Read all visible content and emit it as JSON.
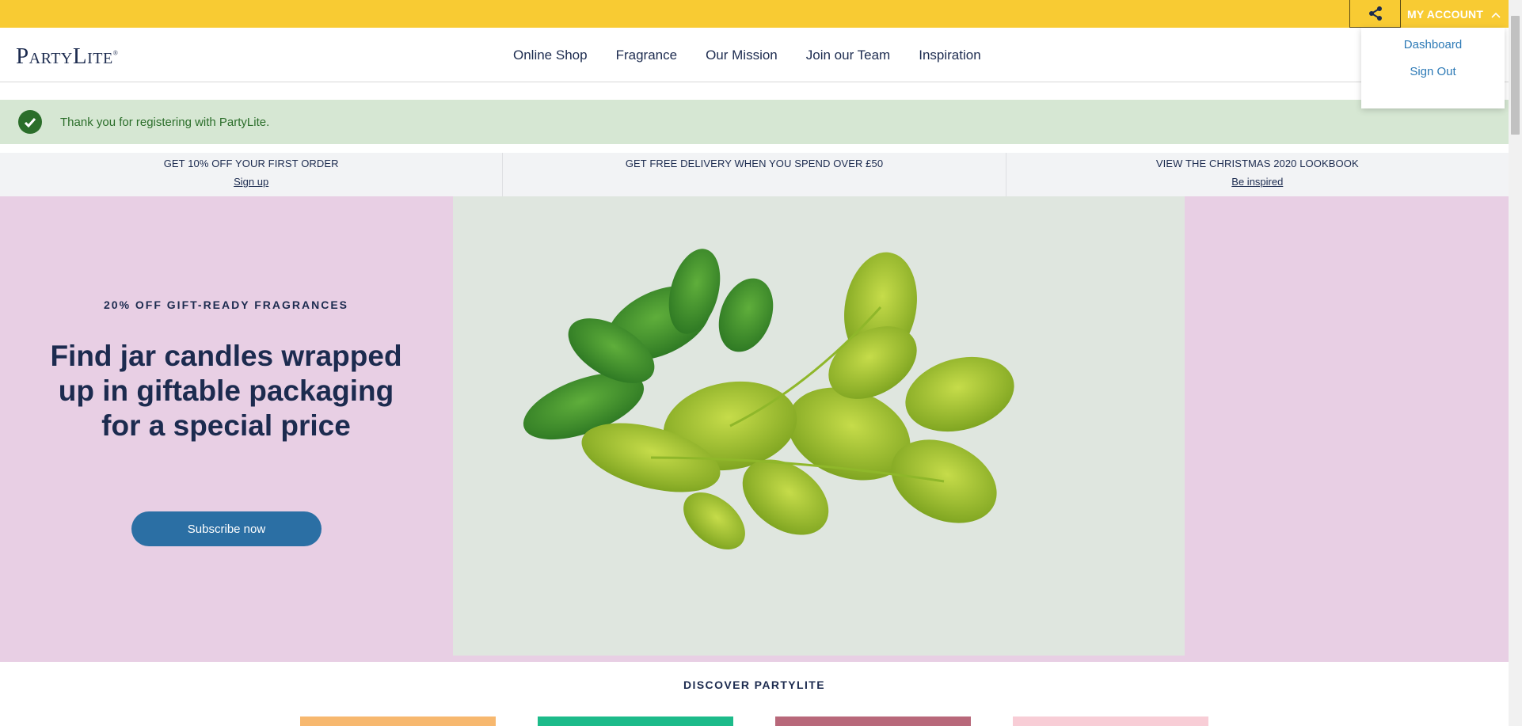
{
  "topbar": {
    "share_icon": "share-icon",
    "account_label": "MY ACCOUNT",
    "account_chevron": "chevron-up-icon",
    "background": "#f8cb33"
  },
  "header": {
    "logo_text": "PartyLite",
    "logo_mark": "®",
    "nav": [
      "Online Shop",
      "Fragrance",
      "Our Mission",
      "Join our Team",
      "Inspiration"
    ]
  },
  "account_dropdown": {
    "items": [
      "Dashboard",
      "Sign Out"
    ]
  },
  "success_banner": {
    "icon": "check-circle-icon",
    "message": "Thank you for registering with PartyLite.",
    "background": "#d6e7d3"
  },
  "promos": [
    {
      "title": "GET 10% OFF YOUR FIRST ORDER",
      "link": "Sign up"
    },
    {
      "title": "GET FREE DELIVERY WHEN YOU SPEND OVER £50",
      "link": ""
    },
    {
      "title": "VIEW THE CHRISTMAS 2020 LOOKBOOK",
      "link": "Be inspired"
    }
  ],
  "hero": {
    "eyebrow": "20% OFF GIFT-READY FRAGRANCES",
    "headline": "Find jar candles wrapped up in giftable packaging for a special price",
    "cta": "Subscribe now",
    "background": "#e8cfe4",
    "image": "basil-and-mint-leaves"
  },
  "discover": {
    "title": "DISCOVER PARTYLITE",
    "tile_colors": [
      "#f7b86f",
      "#1dbb8a",
      "#b8687a",
      "#f8cdd6"
    ]
  },
  "colors": {
    "brand_navy": "#1c2b4f",
    "link_blue": "#2d7ab6",
    "cta_blue": "#2b6fa4"
  }
}
